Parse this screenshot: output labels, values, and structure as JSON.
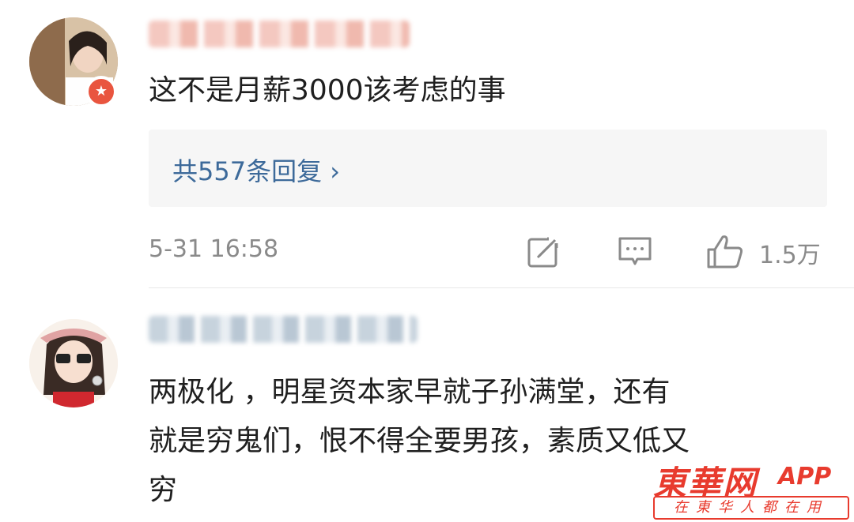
{
  "comments": [
    {
      "text": "这不是月薪3000该考虑的事",
      "replies_label": "共557条回复 ›",
      "time": "5-31 16:58",
      "like_count": "1.5万",
      "icons": {
        "verified": "verified-star-icon",
        "share": "share-icon",
        "comment": "comment-icon",
        "like": "thumb-up-icon"
      }
    },
    {
      "text": "两极化 ，明星资本家早就子孙满堂，还有\n就是穷鬼们，恨不得全要男孩，素质又低又\n穷"
    }
  ],
  "watermark": {
    "brand": "東華网",
    "app": "APP",
    "tagline": "在東华人都在用"
  },
  "colors": {
    "link": "#3d6a9a",
    "meta": "#8a8a8a",
    "brand": "#e83b2e",
    "badge": "#e9553f"
  }
}
